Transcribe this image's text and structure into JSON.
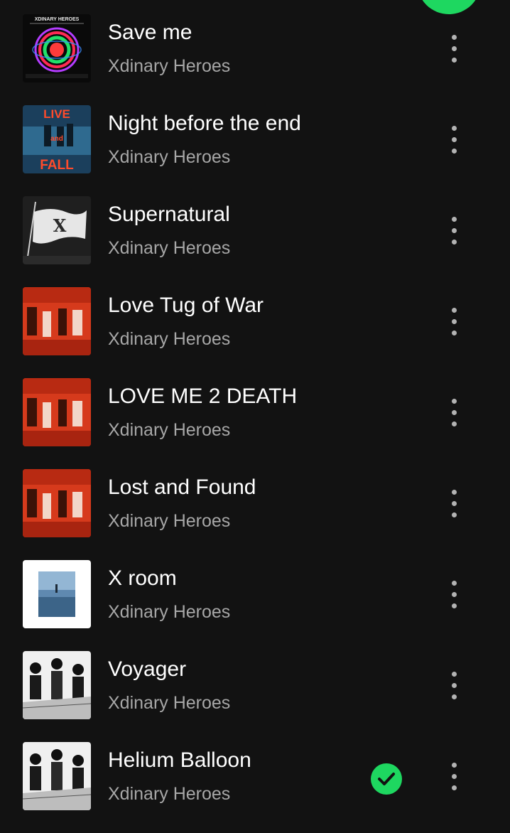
{
  "colors": {
    "background": "#121212",
    "accent": "#1ed760",
    "title": "#ffffff",
    "subtitle": "#a7a7a7",
    "icon": "#b3b3b3"
  },
  "play_button": {
    "icon": "play-icon"
  },
  "tracks": [
    {
      "title": "Save me",
      "artist": "Xdinary Heroes",
      "cover": "save-me-cover",
      "downloaded": false,
      "cover_text": "XDINARY HEROES"
    },
    {
      "title": "Night before the end",
      "artist": "Xdinary Heroes",
      "cover": "live-and-fall-cover",
      "downloaded": false,
      "cover_text": "LIVE and FALL"
    },
    {
      "title": "Supernatural",
      "artist": "Xdinary Heroes",
      "cover": "beautiful-mind-cover",
      "downloaded": false
    },
    {
      "title": "Love Tug of War",
      "artist": "Xdinary Heroes",
      "cover": "live-to-death-cover",
      "downloaded": false
    },
    {
      "title": "LOVE ME 2 DEATH",
      "artist": "Xdinary Heroes",
      "cover": "live-to-death-cover",
      "downloaded": false
    },
    {
      "title": "Lost and Found",
      "artist": "Xdinary Heroes",
      "cover": "live-to-death-cover",
      "downloaded": false
    },
    {
      "title": "X room",
      "artist": "Xdinary Heroes",
      "cover": "x-room-cover",
      "downloaded": false
    },
    {
      "title": "Voyager",
      "artist": "Xdinary Heroes",
      "cover": "manga-cover",
      "downloaded": false
    },
    {
      "title": "Helium Balloon",
      "artist": "Xdinary Heroes",
      "cover": "manga-cover",
      "downloaded": true
    }
  ]
}
